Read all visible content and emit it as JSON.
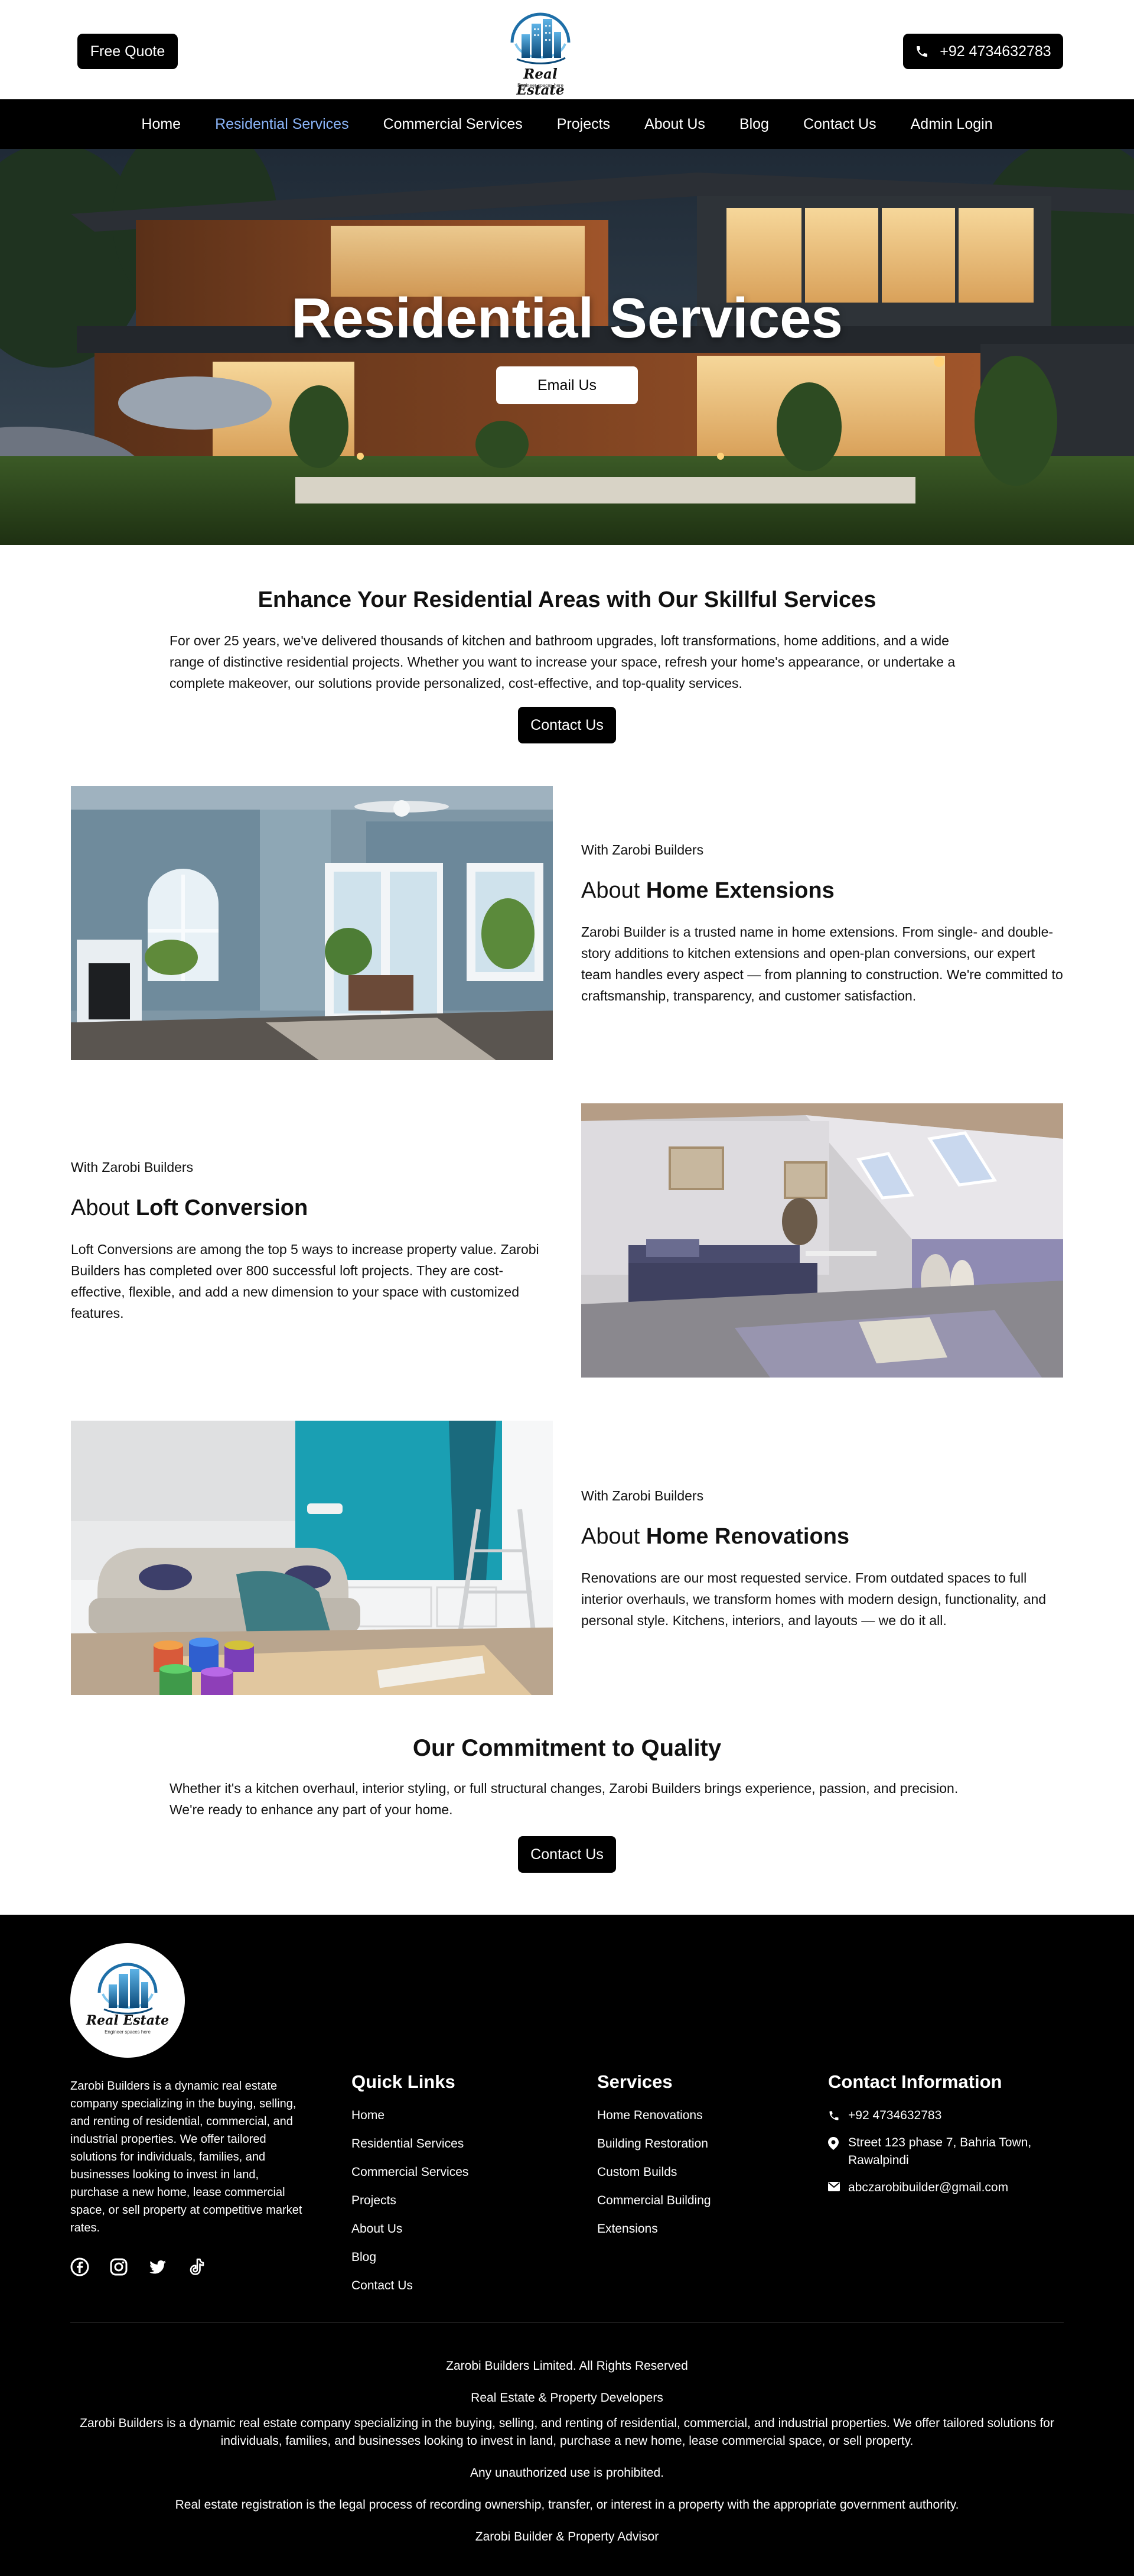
{
  "header": {
    "free_quote": "Free Quote",
    "phone": "+92 4734632783",
    "logo_text": "Real Estate",
    "logo_tagline": "Engineer spaces here"
  },
  "nav": {
    "items": [
      "Home",
      "Residential Services",
      "Commercial Services",
      "Projects",
      "About Us",
      "Blog",
      "Contact Us",
      "Admin Login"
    ],
    "active_index": 1
  },
  "hero": {
    "title": "Residential Services",
    "button": "Email Us"
  },
  "intro": {
    "heading_plain": "Enhance Your Residential Areas with ",
    "heading_bold": "Our Skillful Services",
    "text": "For over 25 years, we've delivered thousands of kitchen and bathroom upgrades, loft transformations, home additions, and a wide range of distinctive residential projects. Whether you want to increase your space, refresh your home's appearance, or undertake a complete makeover, our solutions provide personalized, cost-effective, and top-quality services.",
    "button": "Contact Us"
  },
  "features": [
    {
      "subtitle": "With Zarobi Builders",
      "title_plain": "About ",
      "title_bold": "Home Extensions",
      "text": "Zarobi Builder is a trusted name in home extensions. From single- and double-story additions to kitchen extensions and open-plan conversions, our expert team handles every aspect — from planning to construction. We're committed to craftsmanship, transparency, and customer satisfaction."
    },
    {
      "subtitle": "With Zarobi Builders",
      "title_plain": "About ",
      "title_bold": "Loft Conversion",
      "text": "Loft Conversions are among the top 5 ways to increase property value. Zarobi Builders has completed over 800 successful loft projects. They are cost-effective, flexible, and add a new dimension to your space with customized features."
    },
    {
      "subtitle": "With Zarobi Builders",
      "title_plain": "About ",
      "title_bold": "Home Renovations",
      "text": "Renovations are our most requested service. From outdated spaces to full interior overhauls, we transform homes with modern design, functionality, and personal style. Kitchens, interiors, and layouts — we do it all."
    }
  ],
  "commitment": {
    "heading_plain": "Our Commitment to ",
    "heading_bold": "Quality",
    "text": "Whether it's a kitchen overhaul, interior styling, or full structural changes, Zarobi Builders brings experience, passion, and precision. We're ready to enhance any part of your home.",
    "button": "Contact Us"
  },
  "footer": {
    "about": "Zarobi Builders is a dynamic real estate company specializing in the buying, selling, and renting of residential, commercial, and industrial properties. We offer tailored solutions for individuals, families, and businesses looking to invest in land, purchase a new home, lease commercial space, or sell property at competitive market rates.",
    "social_icons": [
      "facebook-icon",
      "instagram-icon",
      "twitter-icon",
      "tiktok-icon"
    ],
    "quick_links_title": "Quick Links",
    "quick_links": [
      "Home",
      "Residential Services",
      "Commercial Services",
      "Projects",
      "About Us",
      "Blog",
      "Contact Us"
    ],
    "services_title": "Services",
    "services": [
      "Home Renovations",
      "Building Restoration",
      "Custom Builds",
      "Commercial Building",
      "Extensions"
    ],
    "contact_title": "Contact Information",
    "phone": "+92 4734632783",
    "address": "Street 123 phase 7, Bahria Town, Rawalpindi",
    "email": "abczarobibuilder@gmail.com",
    "bottom_lines": [
      "Zarobi Builders Limited. All Rights Reserved",
      "Real Estate & Property Developers",
      "Zarobi Builders is a dynamic real estate company specializing in the buying, selling, and renting of residential, commercial, and industrial properties. We offer tailored solutions for individuals, families, and businesses looking to invest in land, purchase a new home, lease commercial space, or sell property.",
      "Any unauthorized use is prohibited.",
      "Real estate registration is the legal process of recording ownership, transfer, or interest in a property with the appropriate government authority.",
      "Zarobi Builder & Property Advisor"
    ]
  }
}
